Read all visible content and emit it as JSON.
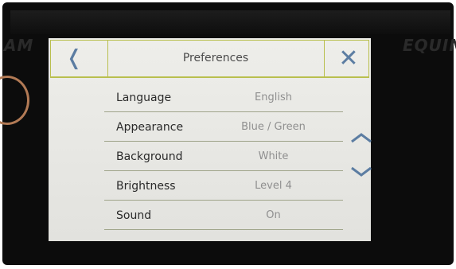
{
  "device": {
    "bg_left_text": "AM",
    "bg_right_text": "EQUIN"
  },
  "header": {
    "back_icon": "chevron-left-icon",
    "back_glyph": "❬",
    "title": "Preferences",
    "close_icon": "close-icon",
    "close_glyph": "✕"
  },
  "settings": [
    {
      "label": "Language",
      "value": "English"
    },
    {
      "label": "Appearance",
      "value": "Blue / Green"
    },
    {
      "label": "Background",
      "value": "White"
    },
    {
      "label": "Brightness",
      "value": "Level 4"
    },
    {
      "label": "Sound",
      "value": "On"
    }
  ],
  "scroll": {
    "up_icon": "chevron-up-icon",
    "down_icon": "chevron-down-icon"
  },
  "colors": {
    "accent_blue": "#5c7da2",
    "header_line": "#b9bf4e",
    "screen_bg": "#e8e8e4",
    "bezel": "#0c0c0c"
  }
}
